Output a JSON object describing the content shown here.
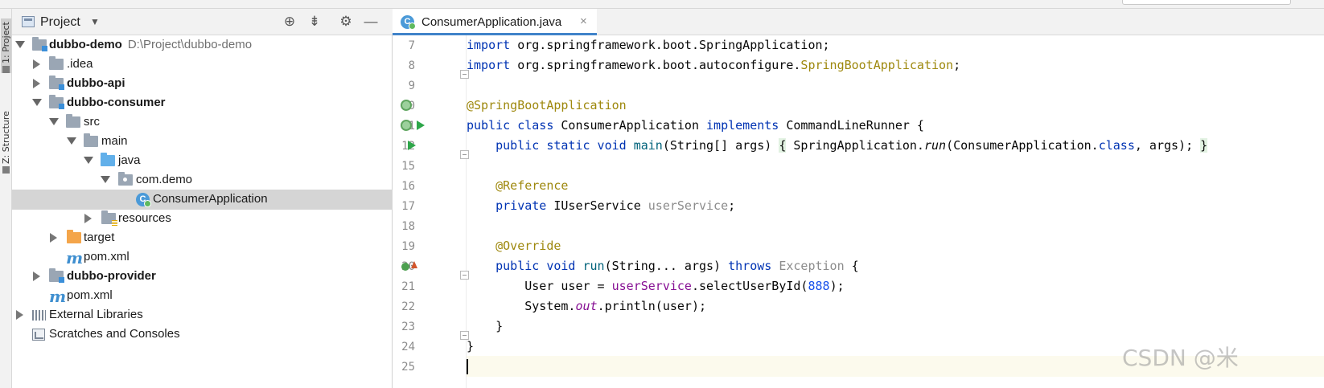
{
  "project_panel": {
    "title": "Project",
    "view_mode_icon": "chevron-down-icon",
    "toolbar_icons": [
      "locate-icon",
      "collapse-all-icon",
      "gear-icon",
      "hide-icon"
    ]
  },
  "side_tabs": {
    "project": "1: Project",
    "structure": "Z: Structure"
  },
  "tree": {
    "root": {
      "label": "dubbo-demo",
      "path": "D:\\Project\\dubbo-demo"
    },
    "idea": ".idea",
    "api": "dubbo-api",
    "consumer": "dubbo-consumer",
    "src": "src",
    "main": "main",
    "java": "java",
    "pkg": "com.demo",
    "app_class": "ConsumerApplication",
    "resources": "resources",
    "target": "target",
    "consumer_pom": "pom.xml",
    "provider": "dubbo-provider",
    "root_pom": "pom.xml",
    "ext_libs": "External Libraries",
    "scratches": "Scratches and Consoles"
  },
  "editor": {
    "tab_label": "ConsumerApplication.java",
    "tab_close": "×",
    "line_numbers": [
      "7",
      "8",
      "9",
      "10",
      "11",
      "12",
      "15",
      "16",
      "17",
      "18",
      "19",
      "20",
      "21",
      "22",
      "23",
      "24",
      "25"
    ],
    "code": {
      "l7": {
        "kw": "import",
        "rest": " org.springframework.boot.SpringApplication;"
      },
      "l8": {
        "kw": "import",
        "rest": " org.springframework.boot.autoconfigure.",
        "ann": "SpringBootApplication",
        "end": ";"
      },
      "l10": {
        "ann": "@SpringBootApplication"
      },
      "l11": {
        "kw1": "public class",
        "name": " ConsumerApplication ",
        "kw2": "implements",
        "rest": " CommandLineRunner {"
      },
      "l12": {
        "indent": "    ",
        "kw": "public static void",
        "sp": " ",
        "method": "main",
        "args": "(String[] args) ",
        "ob": "{",
        "call1": " SpringApplication.",
        "run": "run",
        "call2": "(ConsumerApplication.",
        "cls": "class",
        "call3": ", args); ",
        "cb": "}"
      },
      "l16": {
        "indent": "    ",
        "ann": "@Reference"
      },
      "l17": {
        "indent": "    ",
        "kw": "private",
        "type": " IUserService ",
        "field": "userService",
        "end": ";"
      },
      "l19": {
        "indent": "    ",
        "ann": "@Override"
      },
      "l20": {
        "indent": "    ",
        "kw1": "public void",
        "sp": " ",
        "method": "run",
        "args": "(String... args) ",
        "kw2": "throws",
        "sp2": " ",
        "exc": "Exception",
        "end": " {"
      },
      "l21": {
        "indent": "        ",
        "decl": "User user = ",
        "field": "userService",
        "call": ".selectUserById(",
        "num": "888",
        "end": ");"
      },
      "l22": {
        "indent": "        ",
        "pre": "System.",
        "out": "out",
        "post": ".println(user);"
      },
      "l23": {
        "indent": "    ",
        "text": "}"
      },
      "l24": {
        "text": "}"
      }
    }
  },
  "watermark": "CSDN @米",
  "colors": {
    "keyword": "#0033b3",
    "annotation": "#9e880d",
    "field": "#871094",
    "number": "#1750eb",
    "selection": "#d5d5d5",
    "tab_underline": "#4083c9"
  }
}
